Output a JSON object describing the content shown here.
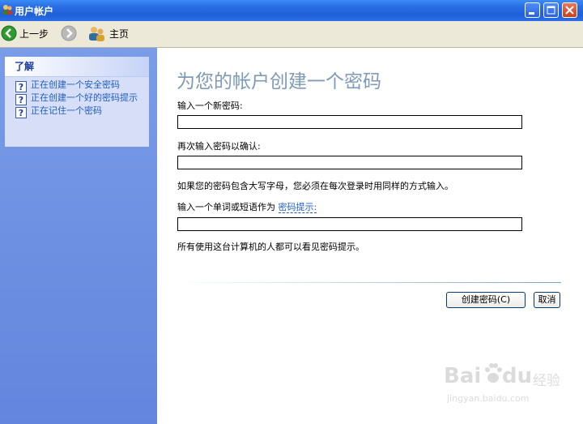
{
  "window": {
    "title": "用户帐户"
  },
  "toolbar": {
    "back_label": "上一步",
    "home_label": "主页"
  },
  "sidebar": {
    "panel_title": "了解",
    "tasks": [
      {
        "label": "正在创建一个安全密码"
      },
      {
        "label": "正在创建一个好的密码提示"
      },
      {
        "label": "正在记住一个密码"
      }
    ]
  },
  "main": {
    "title": "为您的帐户创建一个密码",
    "new_password_label": "输入一个新密码:",
    "confirm_label": "再次输入密码以确认:",
    "case_note": "如果您的密码包含大写字母，您必须在每次登录时用同样的方式输入。",
    "hint_label_prefix": "输入一个单词或短语作为",
    "hint_link": "密码提示:",
    "hint_note": "所有使用这台计算机的人都可以看见密码提示。",
    "new_password_value": "",
    "confirm_value": "",
    "hint_value": "",
    "create_button": "创建密码(C)",
    "cancel_button": "取消"
  },
  "watermark": {
    "brand": "Bai",
    "brand2": "du",
    "product": "经验",
    "url": "jingyan.baidu.com"
  }
}
